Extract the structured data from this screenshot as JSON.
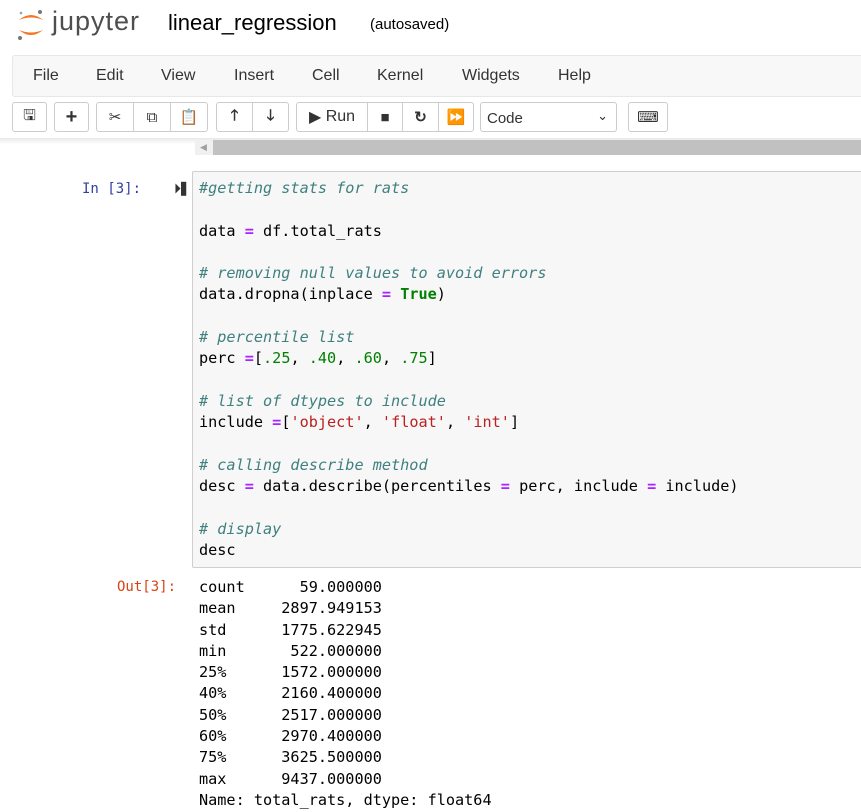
{
  "header": {
    "brand": "jupyter",
    "notebook_name": "linear_regression",
    "autosave_status": "(autosaved)"
  },
  "menu": [
    "File",
    "Edit",
    "View",
    "Insert",
    "Cell",
    "Kernel",
    "Widgets",
    "Help"
  ],
  "toolbar": {
    "run_label": "Run",
    "cell_type": "Code",
    "icons": [
      "save-icon",
      "plus-icon",
      "cut-icon",
      "copy-icon",
      "paste-icon",
      "arrow-up-icon",
      "arrow-down-icon",
      "play-icon",
      "stop-icon",
      "restart-icon",
      "fast-forward-icon",
      "keyboard-icon"
    ]
  },
  "cell": {
    "in_prompt": "In [3]:",
    "out_prompt": "Out[3]:",
    "code": [
      [
        [
          "cm",
          "#getting stats for rats"
        ]
      ],
      [],
      [
        [
          "",
          "data "
        ],
        [
          "op",
          "="
        ],
        [
          "",
          " df.total_rats"
        ]
      ],
      [],
      [
        [
          "cm",
          "# removing null values to avoid errors"
        ]
      ],
      [
        [
          "",
          "data.dropna(inplace "
        ],
        [
          "op",
          "="
        ],
        [
          "",
          " "
        ],
        [
          "kw",
          "True"
        ],
        [
          "",
          ")"
        ]
      ],
      [],
      [
        [
          "cm",
          "# percentile list"
        ]
      ],
      [
        [
          "",
          "perc "
        ],
        [
          "op",
          "="
        ],
        [
          "",
          "["
        ],
        [
          "num",
          ".25"
        ],
        [
          "",
          ", "
        ],
        [
          "num",
          ".40"
        ],
        [
          "",
          ", "
        ],
        [
          "num",
          ".60"
        ],
        [
          "",
          ", "
        ],
        [
          "num",
          ".75"
        ],
        [
          "",
          "]"
        ]
      ],
      [],
      [
        [
          "cm",
          "# list of dtypes to include"
        ]
      ],
      [
        [
          "",
          "include "
        ],
        [
          "op",
          "="
        ],
        [
          "",
          "["
        ],
        [
          "str",
          "'object'"
        ],
        [
          "",
          ", "
        ],
        [
          "str",
          "'float'"
        ],
        [
          "",
          ", "
        ],
        [
          "str",
          "'int'"
        ],
        [
          "",
          "]"
        ]
      ],
      [],
      [
        [
          "cm",
          "# calling describe method"
        ]
      ],
      [
        [
          "",
          "desc "
        ],
        [
          "op",
          "="
        ],
        [
          "",
          " data.describe(percentiles "
        ],
        [
          "op",
          "="
        ],
        [
          "",
          " perc, include "
        ],
        [
          "op",
          "="
        ],
        [
          "",
          " include)"
        ]
      ],
      [],
      [
        [
          "cm",
          "# display"
        ]
      ],
      [
        [
          "",
          "desc"
        ]
      ]
    ],
    "output": [
      "count      59.000000",
      "mean     2897.949153",
      "std      1775.622945",
      "min       522.000000",
      "25%      1572.000000",
      "40%      2160.400000",
      "50%      2517.000000",
      "60%      2970.400000",
      "75%      3625.500000",
      "max      9437.000000",
      "Name: total_rats, dtype: float64"
    ]
  }
}
